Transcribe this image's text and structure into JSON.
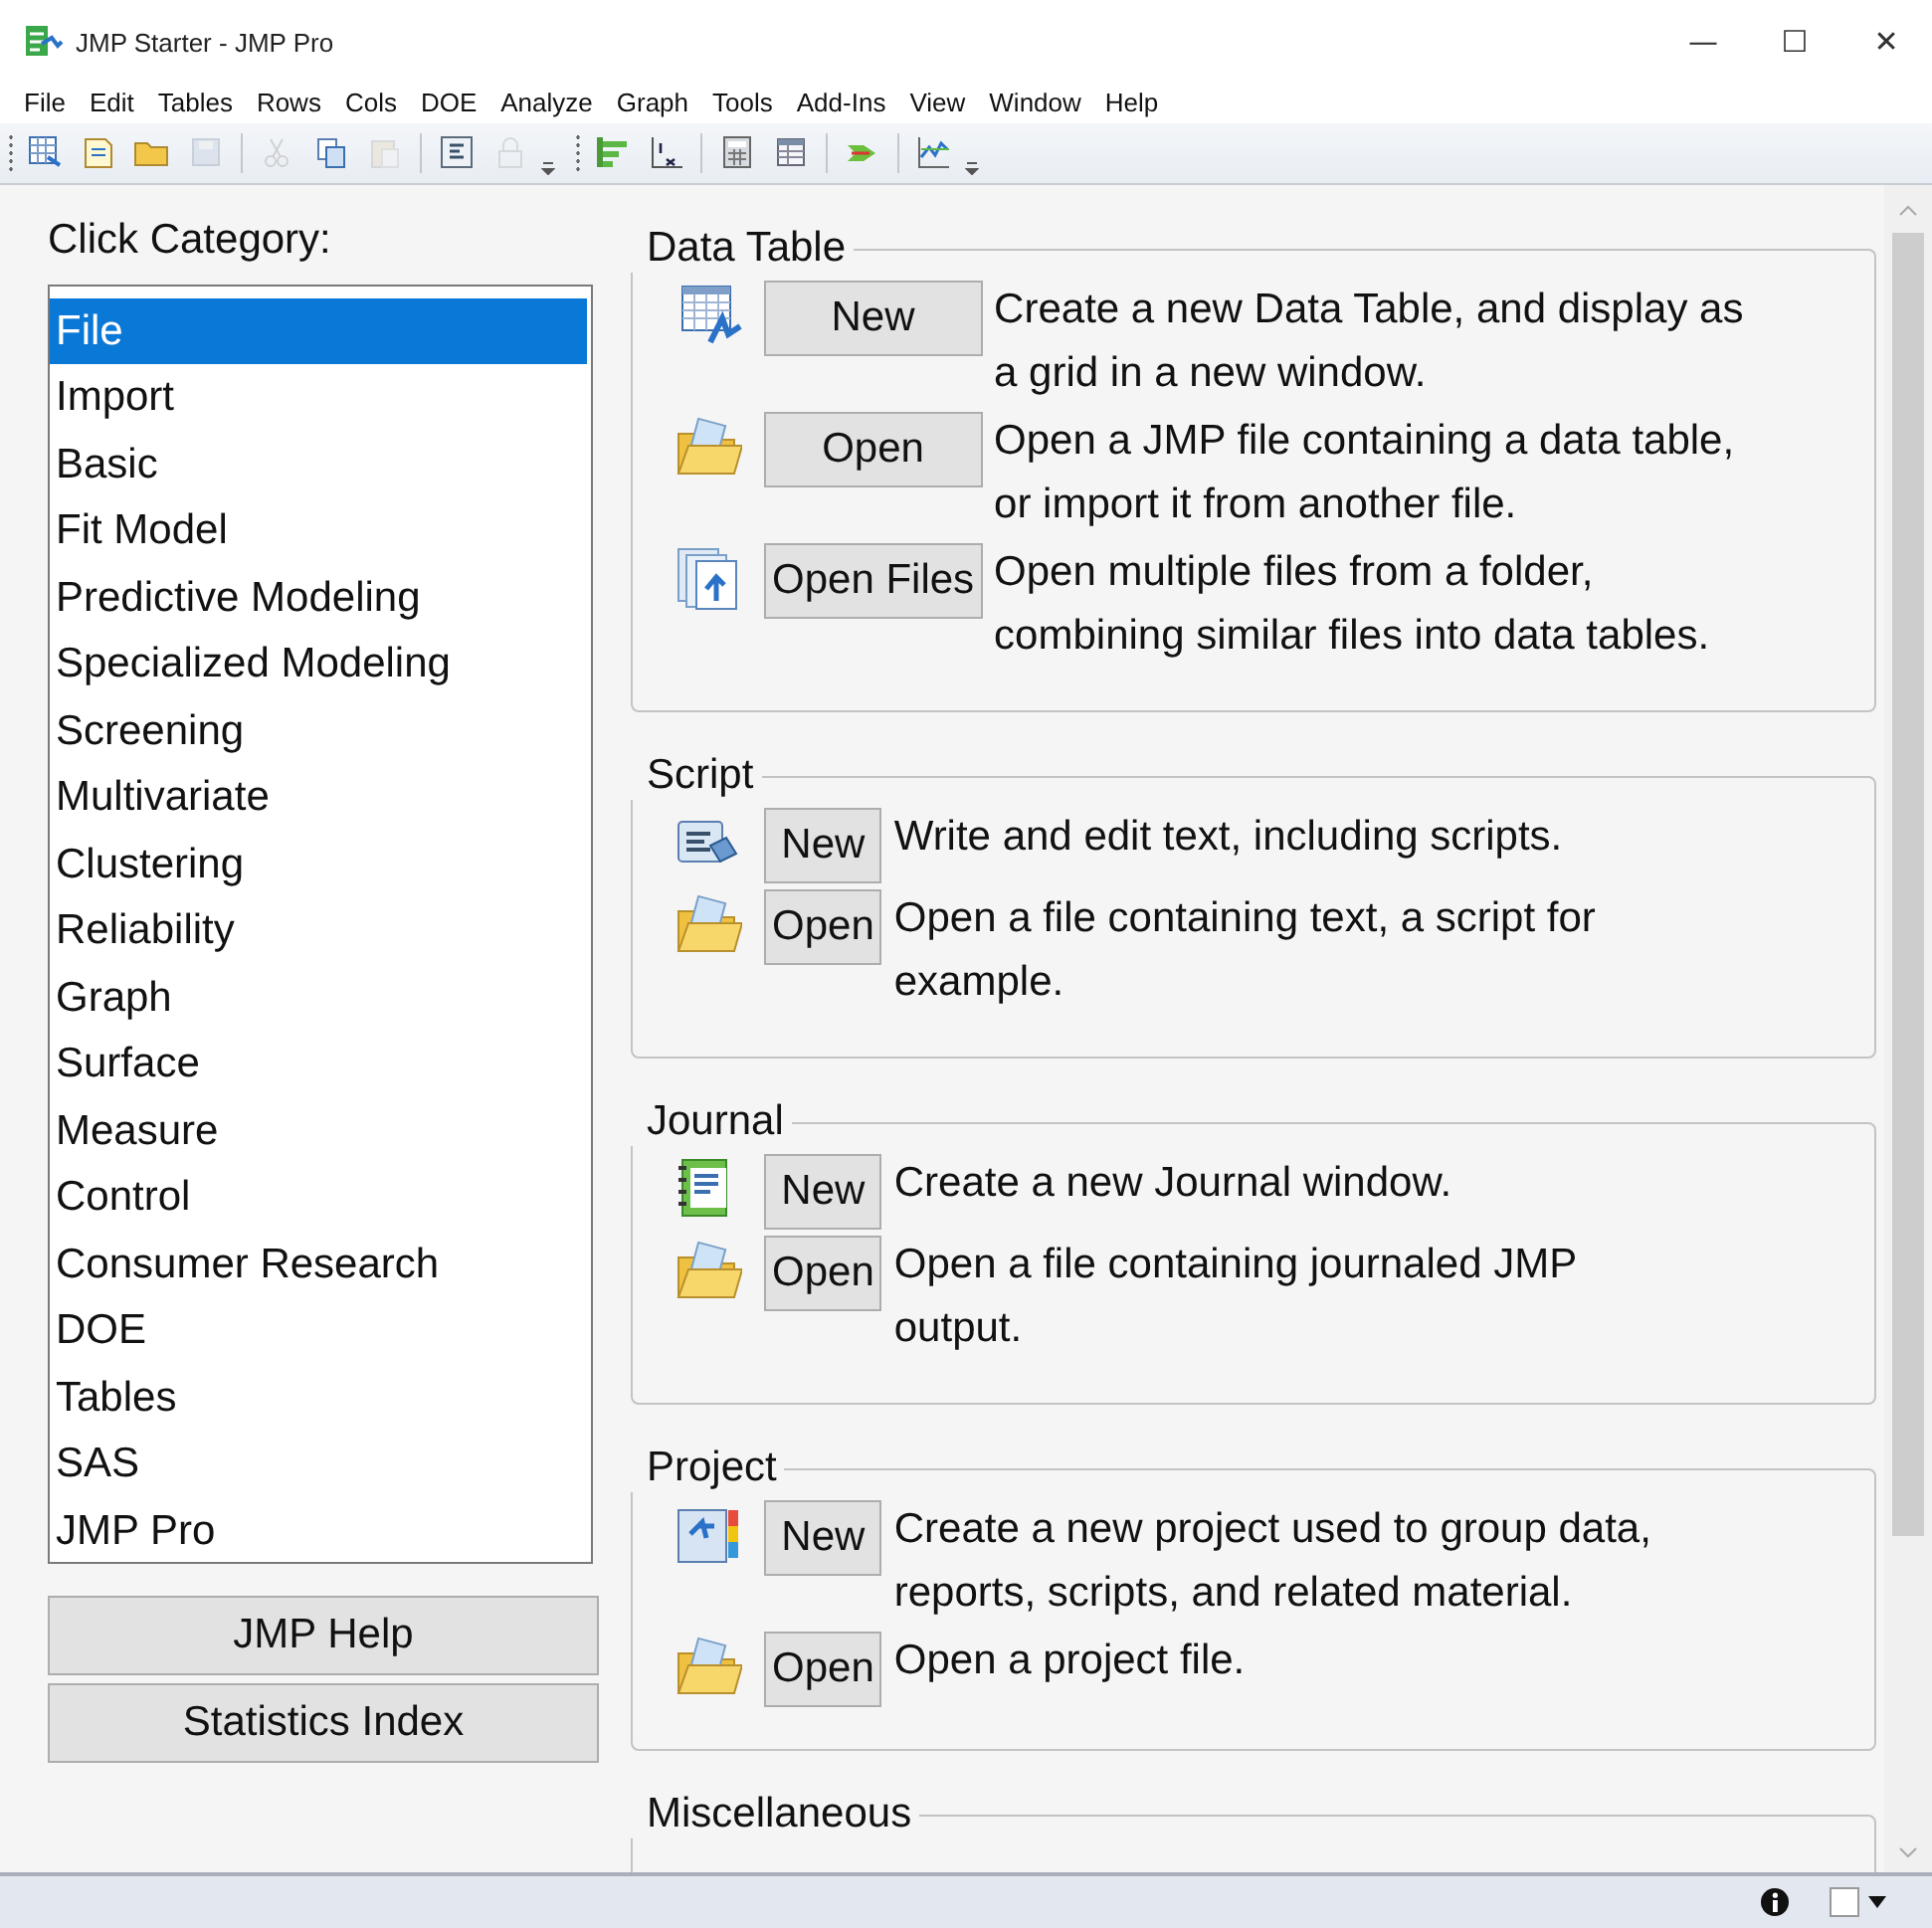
{
  "window": {
    "title": "JMP Starter - JMP Pro",
    "controls": [
      "—",
      "☐",
      "✕"
    ]
  },
  "menu": [
    "File",
    "Edit",
    "Tables",
    "Rows",
    "Cols",
    "DOE",
    "Analyze",
    "Graph",
    "Tools",
    "Add-Ins",
    "View",
    "Window",
    "Help"
  ],
  "toolbar": [
    {
      "kind": "grid",
      "disabled": false
    },
    {
      "kind": "newfile",
      "disabled": false
    },
    {
      "kind": "folder",
      "disabled": false
    },
    {
      "kind": "save",
      "disabled": true
    },
    {
      "kind": "sep"
    },
    {
      "kind": "cut",
      "disabled": true
    },
    {
      "kind": "copy",
      "disabled": false
    },
    {
      "kind": "paste",
      "disabled": true
    },
    {
      "kind": "sep"
    },
    {
      "kind": "script",
      "disabled": false
    },
    {
      "kind": "lock",
      "disabled": true
    },
    {
      "kind": "more"
    },
    {
      "kind": "grip"
    },
    {
      "kind": "bars",
      "disabled": false
    },
    {
      "kind": "fit",
      "disabled": false
    },
    {
      "kind": "sep"
    },
    {
      "kind": "calc",
      "disabled": false
    },
    {
      "kind": "table",
      "disabled": false
    },
    {
      "kind": "sep"
    },
    {
      "kind": "arrow",
      "disabled": false
    },
    {
      "kind": "sep"
    },
    {
      "kind": "chart",
      "disabled": false
    },
    {
      "kind": "more"
    }
  ],
  "categories": {
    "heading": "Click Category:",
    "items": [
      {
        "label": "File",
        "selected": true
      },
      {
        "label": "Import",
        "selected": false
      },
      {
        "label": "Basic",
        "selected": false
      },
      {
        "label": "Fit Model",
        "selected": false
      },
      {
        "label": "Predictive Modeling",
        "selected": false
      },
      {
        "label": "Specialized Modeling",
        "selected": false
      },
      {
        "label": "Screening",
        "selected": false
      },
      {
        "label": "Multivariate",
        "selected": false
      },
      {
        "label": "Clustering",
        "selected": false
      },
      {
        "label": "Reliability",
        "selected": false
      },
      {
        "label": "Graph",
        "selected": false
      },
      {
        "label": "Surface",
        "selected": false
      },
      {
        "label": "Measure",
        "selected": false
      },
      {
        "label": "Control",
        "selected": false
      },
      {
        "label": "Consumer Research",
        "selected": false
      },
      {
        "label": "DOE",
        "selected": false
      },
      {
        "label": "Tables",
        "selected": false
      },
      {
        "label": "SAS",
        "selected": false
      },
      {
        "label": "JMP Pro",
        "selected": false
      }
    ]
  },
  "side_buttons": [
    "JMP Help",
    "Statistics Index"
  ],
  "sections": [
    {
      "title": "Data Table",
      "rows": [
        {
          "kind": "table",
          "button": "New",
          "description": "Create a new Data Table, and display as a grid in a new window."
        },
        {
          "kind": "folder",
          "button": "Open",
          "description": "Open a JMP file containing a data table, or import it from another file."
        },
        {
          "kind": "files",
          "button": "Open Files",
          "description": "Open multiple files from a folder, combining similar files into data tables."
        }
      ]
    },
    {
      "title": "Script",
      "rows": [
        {
          "kind": "script",
          "button": "New",
          "description": "Write and edit text, including scripts."
        },
        {
          "kind": "folder",
          "button": "Open",
          "description": "Open a file containing text, a script for example."
        }
      ]
    },
    {
      "title": "Journal",
      "rows": [
        {
          "kind": "journal",
          "button": "New",
          "description": "Create a new Journal window."
        },
        {
          "kind": "folder",
          "button": "Open",
          "description": "Open a file containing journaled JMP output."
        }
      ]
    },
    {
      "title": "Project",
      "rows": [
        {
          "kind": "project",
          "button": "New",
          "description": "Create a new project used to group data, reports, scripts, and related material."
        },
        {
          "kind": "folder",
          "button": "Open",
          "description": "Open a project file."
        }
      ]
    },
    {
      "title": "Miscellaneous"
    }
  ]
}
